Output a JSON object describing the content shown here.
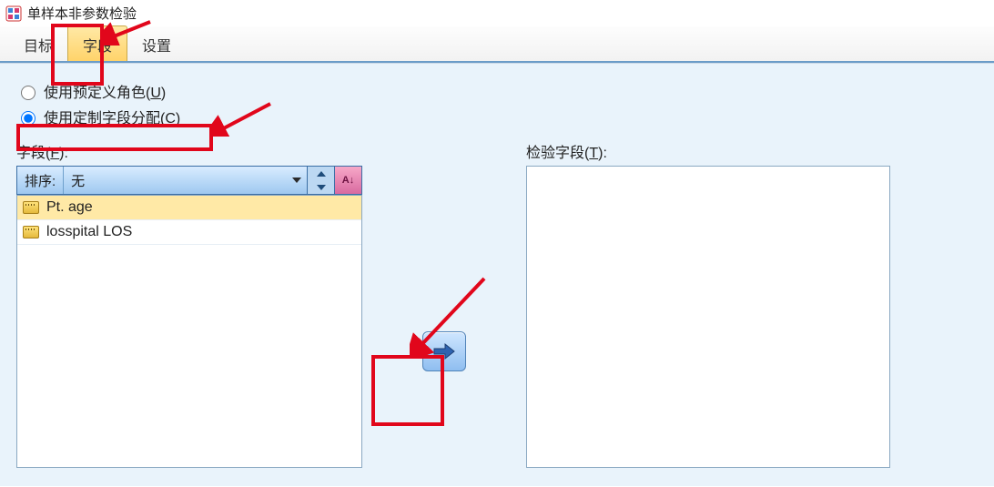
{
  "window": {
    "title": "单样本非参数检验"
  },
  "tabs": {
    "goal": "目标",
    "fields": "字段",
    "settings": "设置"
  },
  "roles": {
    "predefined": "使用预定义角色",
    "predefined_hotkey": "U",
    "custom": "使用定制字段分配",
    "custom_hotkey": "C"
  },
  "left": {
    "label": "字段",
    "label_hotkey": "F",
    "sort_label": "排序:",
    "sort_value": "无",
    "az_label": "A↓",
    "items": [
      {
        "name": "Pt. age"
      },
      {
        "name": "losspital LOS"
      }
    ]
  },
  "right": {
    "label": "检验字段",
    "label_hotkey": "T"
  },
  "icons": {
    "app": "app-grid-icon",
    "ruler": "ruler-icon",
    "arrow_right": "arrow-right-icon"
  },
  "colors": {
    "accent_red": "#e1061b",
    "panel_bg": "#e9f3fb",
    "tab_active": "#ffd36a"
  }
}
